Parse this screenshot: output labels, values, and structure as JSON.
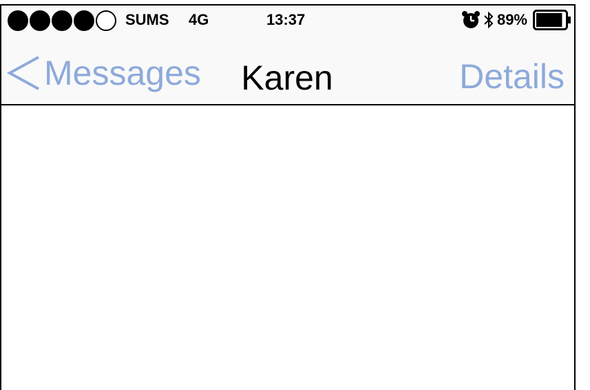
{
  "status_bar": {
    "signal_bars_filled": 4,
    "signal_bars_total": 5,
    "carrier": "SUMS",
    "network": "4G",
    "time": "13:37",
    "battery_percent": "89%",
    "battery_level": 0.89,
    "icons": [
      "alarm-icon",
      "bluetooth-icon",
      "battery-icon"
    ]
  },
  "nav_bar": {
    "back_label": "Messages",
    "title": "Karen",
    "details_label": "Details",
    "accent_color": "#8eaadb"
  },
  "conversation": {
    "messages": []
  }
}
